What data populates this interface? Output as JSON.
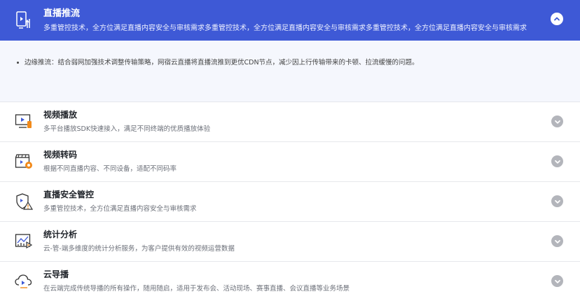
{
  "active_item": {
    "title": "直播推流",
    "description": "多重管控技术，全方位满足直播内容安全与审核需求多重管控技术，全方位满足直播内容安全与审核需求多重管控技术，全方位满足直播内容安全与审核需求",
    "icon": "phone-stream-icon",
    "toggle_icon": "chevron-up-icon",
    "panel_points": [
      "边缘推流：结合弱网加强技术调整传输策略，网宿云直播将直播流推到更优CDN节点，减少因上行传输带来的卡顿、拉流缓慢的问题。"
    ]
  },
  "items": [
    {
      "title": "视频播放",
      "description": "多平台播放SDK快速接入，满足不同终端的优质播放体验",
      "icon": "monitor-play-icon"
    },
    {
      "title": "视频转码",
      "description": "根据不同直播内容、不同设备，适配不同码率",
      "icon": "clapper-transcode-icon"
    },
    {
      "title": "直播安全管控",
      "description": "多重管控技术，全方位满足直播内容安全与审核需求",
      "icon": "shield-warning-icon"
    },
    {
      "title": "统计分析",
      "description": "云-管-端多维度的统计分析服务，为客户提供有效的视频运营数据",
      "icon": "chart-analysis-icon"
    },
    {
      "title": "云导播",
      "description": "在云端完成传统导播的所有操作，随用随启，适用于发布会、活动现场、赛事直播、会议直播等业务场景",
      "icon": "cloud-play-icon"
    }
  ],
  "colors": {
    "accent": "#3e59d6",
    "panel_bg": "#f5f7fd",
    "icon_orange": "#f28a1a",
    "toggle_grey": "#b3b5bb"
  }
}
